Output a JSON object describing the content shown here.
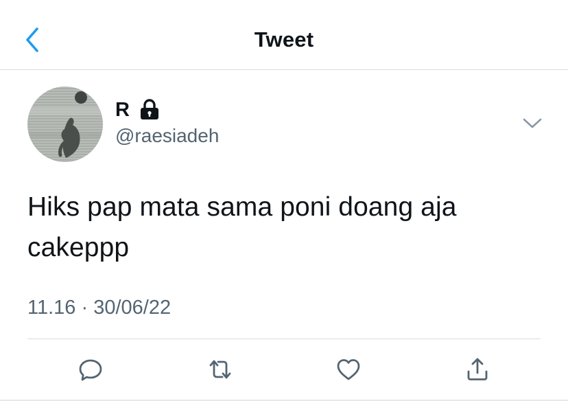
{
  "header": {
    "title": "Tweet",
    "back_icon": "chevron-left-icon"
  },
  "author": {
    "display_name": "R",
    "handle": "@raesiadeh",
    "protected_icon": "lock-icon",
    "avatar_icon": "avatar-image"
  },
  "tweet": {
    "text": "Hiks pap mata sama poni doang aja cakeppp",
    "time": "11.16",
    "separator": "·",
    "date": "30/06/22"
  },
  "actions": [
    {
      "name": "reply",
      "icon": "comment-icon"
    },
    {
      "name": "retweet",
      "icon": "retweet-icon"
    },
    {
      "name": "like",
      "icon": "heart-icon"
    },
    {
      "name": "share",
      "icon": "share-icon"
    }
  ],
  "colors": {
    "accent": "#1d9bf0",
    "text_primary": "#0f1419",
    "text_secondary": "#536471",
    "divider": "#d7dbdf"
  }
}
